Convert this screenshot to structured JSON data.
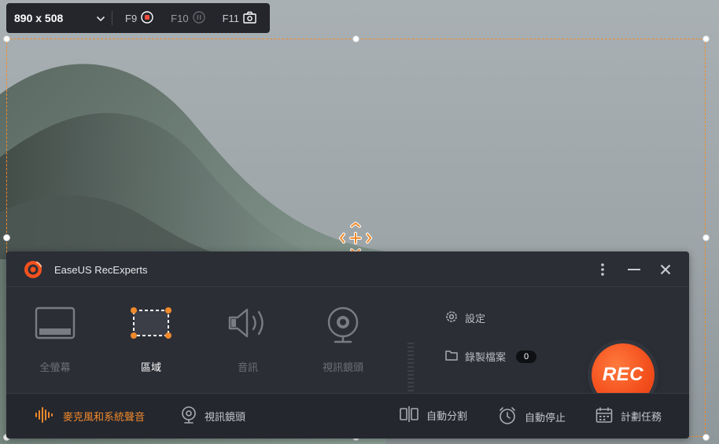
{
  "theme": {
    "accent": "#f08a2c",
    "rec_color": "#f4511e",
    "panel_bg": "#2c2e36",
    "toolbar_bg": "#24262c"
  },
  "top_toolbar": {
    "size_value": "890 x 508",
    "hotkeys": [
      {
        "key": "F9",
        "icon": "record-circle-icon"
      },
      {
        "key": "F10",
        "icon": "pause-circle-icon"
      },
      {
        "key": "F11",
        "icon": "camera-icon"
      }
    ]
  },
  "panel": {
    "app_title": "EaseUS RecExperts",
    "modes": [
      {
        "label": "全螢幕",
        "icon": "monitor-icon",
        "active": false
      },
      {
        "label": "區域",
        "icon": "region-select-icon",
        "active": true
      },
      {
        "label": "音訊",
        "icon": "speaker-icon",
        "active": false
      },
      {
        "label": "視訊鏡頭",
        "icon": "webcam-icon",
        "active": false
      }
    ],
    "settings_label": "設定",
    "recordings_label": "錄製檔案",
    "recordings_count": "0",
    "rec_label": "REC",
    "footer": {
      "audio_source": "麥克風和系統聲音",
      "webcam": "視訊鏡頭",
      "auto_split": "自動分割",
      "auto_stop": "自動停止",
      "schedule": "計劃任務"
    }
  }
}
